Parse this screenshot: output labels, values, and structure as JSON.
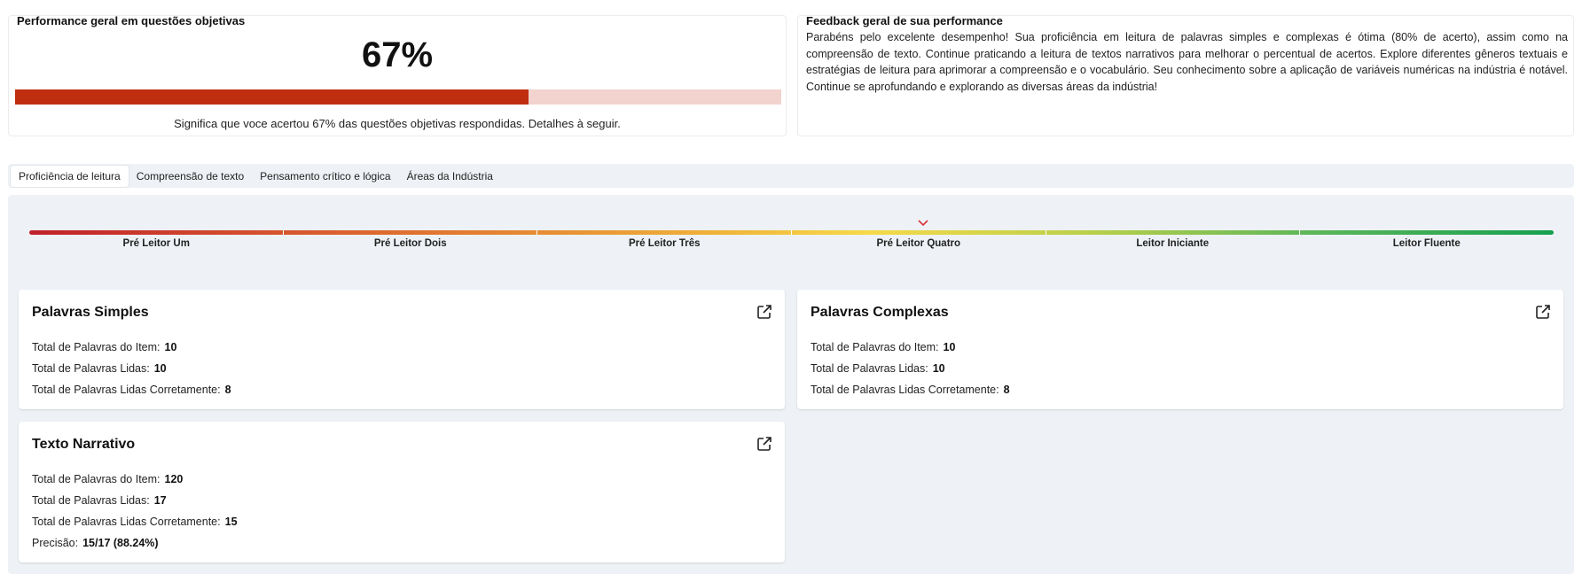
{
  "performance": {
    "title": "Performance geral em questões objetivas",
    "percent_label": "67%",
    "percent_value": 67,
    "caption": "Significa que voce acertou 67% das questões objetivas respondidas. Detalhes à seguir.",
    "colors": {
      "fill": "#bf2e0f",
      "track": "#f2d3ce"
    }
  },
  "feedback": {
    "title": "Feedback geral de sua performance",
    "text": "Parabéns pelo excelente desempenho! Sua proficiência em leitura de palavras simples e complexas é ótima (80% de acerto), assim como na compreensão de texto. Continue praticando a leitura de textos narrativos para melhorar o percentual de acertos. Explore diferentes gêneros textuais e estratégias de leitura para aprimorar a compreensão e o vocabulário. Seu conhecimento sobre a aplicação de variáveis numéricas na indústria é notável. Continue se aprofundando e explorando as diversas áreas da indústria!"
  },
  "tabs": [
    {
      "label": "Proficiência de leitura",
      "active": true
    },
    {
      "label": "Compreensão de texto",
      "active": false
    },
    {
      "label": "Pensamento crítico e lógica",
      "active": false
    },
    {
      "label": "Áreas da Indústria",
      "active": false
    }
  ],
  "scale": {
    "levels": [
      "Pré Leitor Um",
      "Pré Leitor Dois",
      "Pré Leitor Três",
      "Pré Leitor Quatro",
      "Leitor Iniciante",
      "Leitor Fluente"
    ],
    "current_level": "Pré Leitor Quatro",
    "marker_icon": "chevron-down-icon",
    "marker_color": "#d6333b"
  },
  "items": {
    "simples": {
      "title": "Palavras Simples",
      "icon": "external-link-icon",
      "rows": [
        {
          "label": "Total de Palavras do Item:",
          "value": "10"
        },
        {
          "label": "Total de Palavras Lidas:",
          "value": "10"
        },
        {
          "label": "Total de Palavras Lidas Corretamente:",
          "value": "8"
        }
      ]
    },
    "complexas": {
      "title": "Palavras Complexas",
      "icon": "external-link-icon",
      "rows": [
        {
          "label": "Total de Palavras do Item:",
          "value": "10"
        },
        {
          "label": "Total de Palavras Lidas:",
          "value": "10"
        },
        {
          "label": "Total de Palavras Lidas Corretamente:",
          "value": "8"
        }
      ]
    },
    "narrativo": {
      "title": "Texto Narrativo",
      "icon": "external-link-icon",
      "rows": [
        {
          "label": "Total de Palavras do Item:",
          "value": "120"
        },
        {
          "label": "Total de Palavras Lidas:",
          "value": "17"
        },
        {
          "label": "Total de Palavras Lidas Corretamente:",
          "value": "15"
        },
        {
          "label": "Precisão:",
          "value": "15/17 (88.24%)"
        }
      ]
    }
  }
}
